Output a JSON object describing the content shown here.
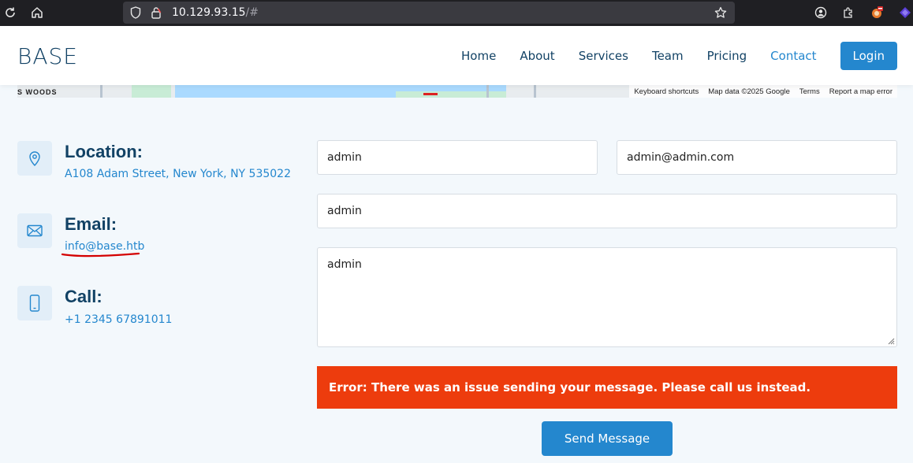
{
  "browser": {
    "url_host": "10.129.93.15",
    "url_path": "/#",
    "icons": [
      "reload-icon",
      "home-icon",
      "shield-icon",
      "lock-icon",
      "star-icon",
      "account-icon",
      "extensions-icon",
      "extension-fox-icon",
      "extension-purple-icon"
    ]
  },
  "site": {
    "logo": "BASE",
    "nav": {
      "items": [
        {
          "label": "Home"
        },
        {
          "label": "About"
        },
        {
          "label": "Services"
        },
        {
          "label": "Team"
        },
        {
          "label": "Pricing"
        },
        {
          "label": "Contact",
          "active": true
        }
      ],
      "login_label": "Login"
    }
  },
  "map": {
    "woods_label": "S WOODS",
    "keyboard_shortcuts": "Keyboard shortcuts",
    "map_data": "Map data ©2025 Google",
    "terms": "Terms",
    "report": "Report a map error"
  },
  "contact_info": {
    "location": {
      "title": "Location:",
      "text": "A108 Adam Street, New York, NY 535022",
      "icon": "map-pin-icon"
    },
    "email": {
      "title": "Email:",
      "text": "info@base.htb",
      "icon": "envelope-icon"
    },
    "call": {
      "title": "Call:",
      "text": "+1 2345 67891011",
      "icon": "phone-icon"
    }
  },
  "form": {
    "name_value": "admin",
    "email_value": "admin@admin.com",
    "subject_value": "admin",
    "message_value": "admin",
    "error_message": "Error: There was an issue sending your message. Please call us instead.",
    "send_label": "Send Message"
  },
  "colors": {
    "accent": "#2487ce",
    "heading": "#124265",
    "error": "#ed3c0d",
    "annotation": "#d40000"
  }
}
